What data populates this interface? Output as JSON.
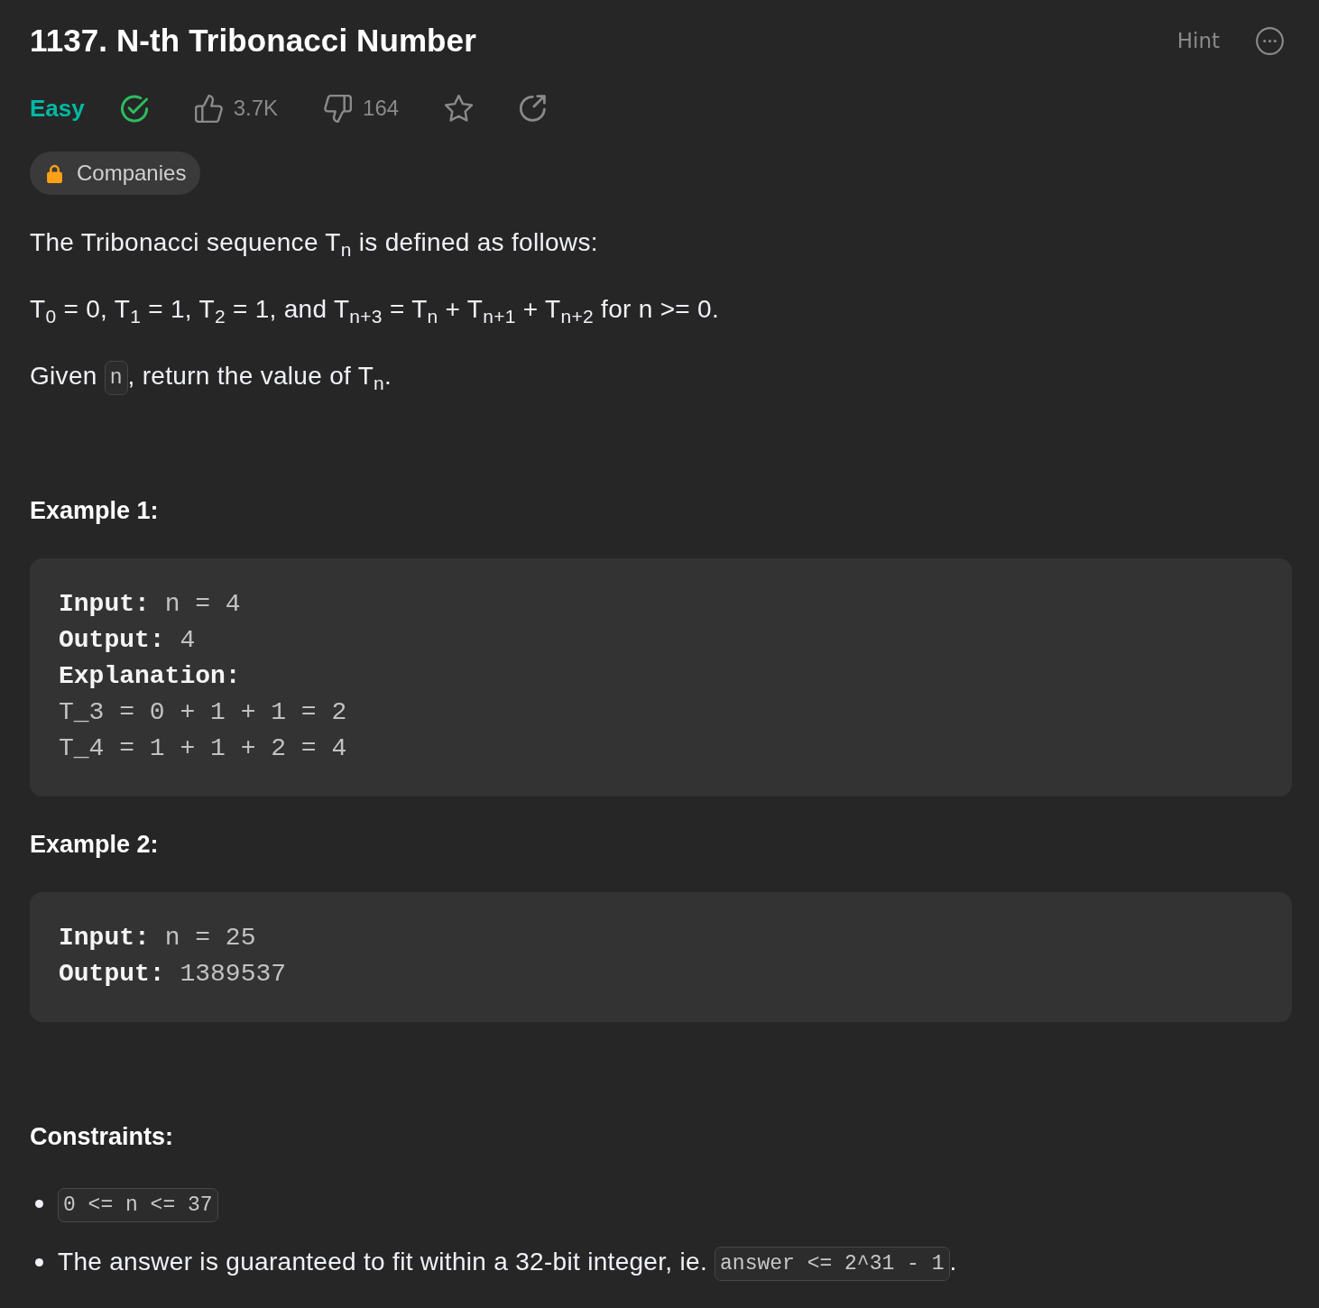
{
  "title": "1137. N-th Tribonacci Number",
  "hint": "Hint",
  "meta": {
    "difficulty": {
      "label": "Easy",
      "kind": "easy"
    },
    "solved": true,
    "likes": "3.7K",
    "dislikes": "164",
    "favorited": false
  },
  "companies": {
    "label": "Companies",
    "locked": true
  },
  "description": [
    {
      "segments": [
        {
          "kind": "text",
          "text": "The Tribonacci sequence T$_{n}$ is defined as follows:"
        }
      ]
    },
    {
      "segments": [
        {
          "kind": "text",
          "text": "T$_{0}$ = 0, T$_{1}$ = 1, T$_{2}$ = 1, and T$_{n+3}$ = T$_{n}$ + T$_{n+1}$ + T$_{n+2}$ for n >= 0."
        }
      ]
    },
    {
      "segments": [
        {
          "kind": "text",
          "text": "Given "
        },
        {
          "kind": "code",
          "text": "n"
        },
        {
          "kind": "text",
          "text": ", return the value of T$_{n}$."
        }
      ]
    }
  ],
  "examples": [
    {
      "title": "Example 1:",
      "lines": [
        {
          "label": "Input:",
          "value": "n = 4"
        },
        {
          "label": "Output:",
          "value": "4"
        },
        {
          "label": "Explanation:"
        },
        {
          "value": "T_3 = 0 + 1 + 1 = 2"
        },
        {
          "value": "T_4 = 1 + 1 + 2 = 4"
        }
      ]
    },
    {
      "title": "Example 2:",
      "lines": [
        {
          "label": "Input:",
          "value": "n = 25"
        },
        {
          "label": "Output:",
          "value": "1389537"
        }
      ]
    }
  ],
  "constraints": {
    "title": "Constraints:",
    "items": [
      {
        "segments": [
          {
            "kind": "code",
            "text": "0 <= n <= 37"
          }
        ]
      },
      {
        "segments": [
          {
            "kind": "text",
            "text": "The answer is guaranteed to fit within a 32-bit integer, ie. "
          },
          {
            "kind": "code",
            "text": "answer <= 2^31 - 1"
          },
          {
            "kind": "text",
            "text": "."
          }
        ]
      }
    ]
  }
}
